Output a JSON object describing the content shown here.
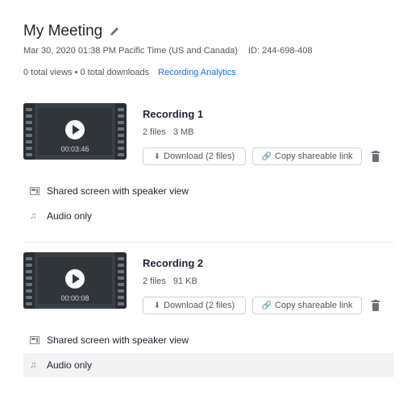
{
  "meeting": {
    "title": "My Meeting",
    "datetime": "Mar 30, 2020 01:38 PM Pacific Time (US and Canada)",
    "id": "ID: 244-698-408",
    "stats": "0 total views • 0 total downloads",
    "analytics_link": "Recording Analytics"
  },
  "recordings": [
    {
      "title": "Recording 1",
      "files": "2 files",
      "size": "3 MB",
      "duration": "00:03:46",
      "download_label": "Download (2 files)",
      "copy_label": "Copy shareable link",
      "file_items": [
        {
          "label": "Shared screen with speaker view",
          "icon": "screen-icon"
        },
        {
          "label": "Audio only",
          "icon": "music-note-icon"
        }
      ]
    },
    {
      "title": "Recording 2",
      "files": "2 files",
      "size": "91 KB",
      "duration": "00:00:08",
      "download_label": "Download (2 files)",
      "copy_label": "Copy shareable link",
      "file_items": [
        {
          "label": "Shared screen with speaker view",
          "icon": "screen-icon"
        },
        {
          "label": "Audio only",
          "icon": "music-note-icon"
        }
      ]
    }
  ],
  "colors": {
    "link": "#0e72ed",
    "text": "#232333",
    "thumbnail": "#3a3f44",
    "hover_row": "#f3f3f5"
  }
}
